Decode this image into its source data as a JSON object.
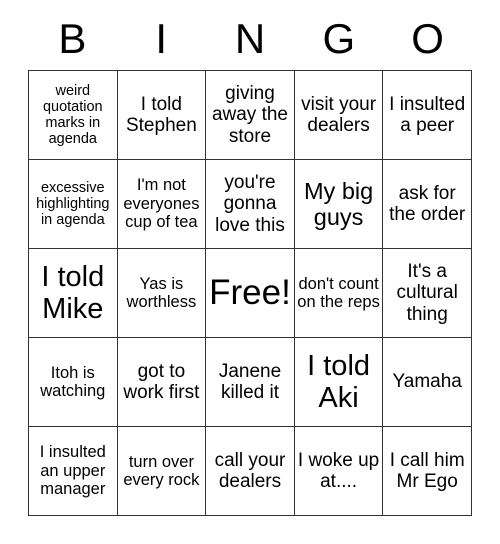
{
  "card": {
    "headers": [
      "B",
      "I",
      "N",
      "G",
      "O"
    ],
    "rows": [
      [
        {
          "text": "weird quotation marks in agenda",
          "size": "xs",
          "free": false
        },
        {
          "text": "I told Stephen",
          "size": "md",
          "free": false
        },
        {
          "text": "giving away the store",
          "size": "md",
          "free": false
        },
        {
          "text": "visit your dealers",
          "size": "md",
          "free": false
        },
        {
          "text": "I insulted a peer",
          "size": "md",
          "free": false
        }
      ],
      [
        {
          "text": "excessive highlighting in agenda",
          "size": "xs",
          "free": false
        },
        {
          "text": "I'm not everyones cup of tea",
          "size": "sm",
          "free": false
        },
        {
          "text": "you're gonna love this",
          "size": "md",
          "free": false
        },
        {
          "text": "My big guys",
          "size": "lg",
          "free": false
        },
        {
          "text": "ask for the order",
          "size": "md",
          "free": false
        }
      ],
      [
        {
          "text": "I told Mike",
          "size": "xl",
          "free": false
        },
        {
          "text": "Yas is worthless",
          "size": "sm",
          "free": false
        },
        {
          "text": "Free!",
          "size": "xxl",
          "free": true
        },
        {
          "text": "don't count on the reps",
          "size": "sm",
          "free": false
        },
        {
          "text": "It's a cultural thing",
          "size": "md",
          "free": false
        }
      ],
      [
        {
          "text": "Itoh is watching",
          "size": "sm",
          "free": false
        },
        {
          "text": "got to work first",
          "size": "md",
          "free": false
        },
        {
          "text": "Janene killed it",
          "size": "md",
          "free": false
        },
        {
          "text": "I told Aki",
          "size": "xl",
          "free": false
        },
        {
          "text": "Yamaha",
          "size": "md",
          "free": false
        }
      ],
      [
        {
          "text": "I insulted an upper manager",
          "size": "sm",
          "free": false
        },
        {
          "text": "turn over every rock",
          "size": "sm",
          "free": false
        },
        {
          "text": "call your dealers",
          "size": "md",
          "free": false
        },
        {
          "text": "I woke up at....",
          "size": "md",
          "free": false
        },
        {
          "text": "I call him Mr Ego",
          "size": "md",
          "free": false
        }
      ]
    ]
  },
  "colors": {
    "background": "#ffffff",
    "text": "#000000",
    "border": "#333333"
  }
}
